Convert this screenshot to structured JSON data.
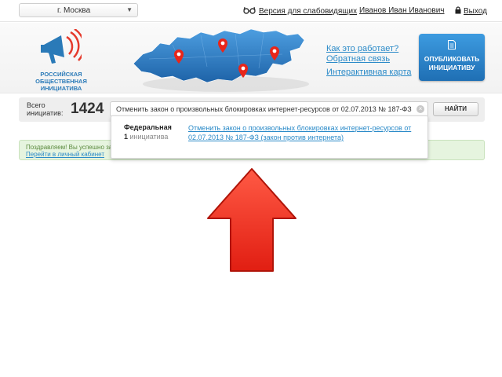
{
  "topbar": {
    "city": "г. Москва",
    "vision_link": "Версия для слабовидящих",
    "user_name": "Иванов Иван Иванович",
    "logout": "Выход"
  },
  "logo": {
    "lines": [
      "РОССИЙСКАЯ",
      "ОБЩЕСТВЕННАЯ",
      "ИНИЦИАТИВА"
    ]
  },
  "header": {
    "links": [
      "Как это работает?",
      "Обратная связь",
      "Интерактивная карта"
    ],
    "publish_button": [
      "ОПУБЛИКОВАТЬ",
      "ИНИЦИАТИВУ"
    ]
  },
  "search": {
    "total_label_1": "Всего",
    "total_label_2": "инициатив:",
    "total_count": "1424",
    "query": "Отменить закон о произвольных блокировках интернет-ресурсов от 02.07.2013 № 187-ФЗ",
    "find_button": "НАЙТИ"
  },
  "dropdown": {
    "category": "Федеральная",
    "count": "1",
    "count_label": "инициатива",
    "result": "Отменить закон о произвольных блокировках интернет-ресурсов от 02.07.2013 № 187-ФЗ (закон против интернета)"
  },
  "success": {
    "message": "Поздравляем! Вы успешно за",
    "cabinet_link": "Перейти в личный кабинет"
  },
  "colors": {
    "accent_blue": "#2a8ac8",
    "publish_button": "#1f6fb4",
    "arrow": "#e8261a",
    "success_bg": "#e6f4df"
  },
  "icons": [
    "glasses-icon",
    "lock-icon",
    "document-icon",
    "megaphone-icon",
    "clear-icon",
    "chevron-down-icon",
    "arrow-up-icon"
  ]
}
